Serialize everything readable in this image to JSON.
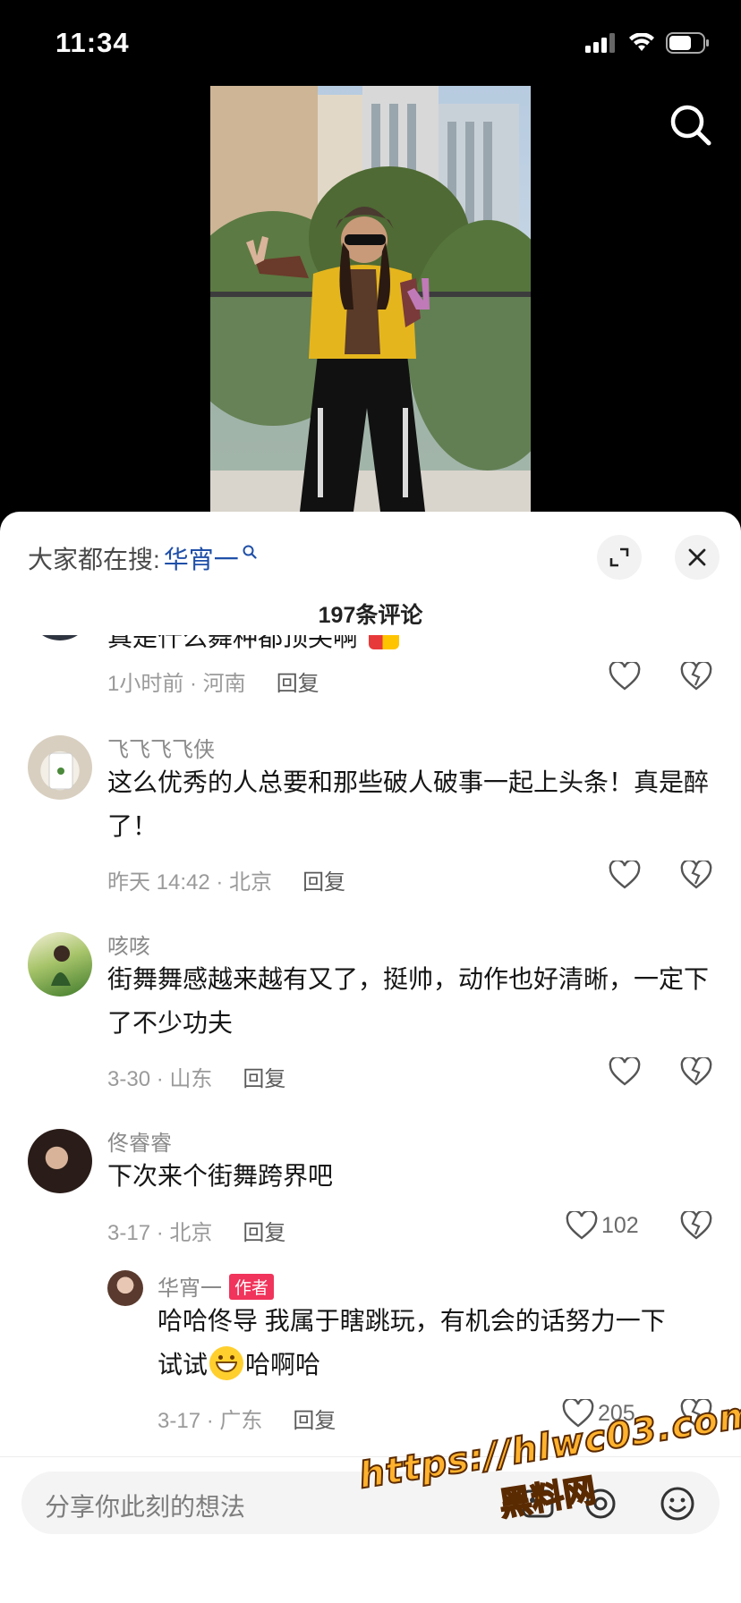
{
  "status_bar": {
    "time": "11:34"
  },
  "sheet": {
    "hot_search_label": "大家都在搜:",
    "hot_search_term": "华宵一",
    "comment_count": "197条评论"
  },
  "comments": [
    {
      "text": "真是什么舞种都顶尖啊",
      "meta": "1小时前 · 河南",
      "reply": "回复"
    },
    {
      "user": "飞飞飞飞侠",
      "text": "这么优秀的人总要和那些破人破事一起上头条！真是醉了！",
      "meta": "昨天 14:42 · 北京",
      "reply": "回复"
    },
    {
      "user": "咳咳",
      "text": "街舞舞感越来越有又了，挺帅，动作也好清晰，一定下了不少功夫",
      "meta": "3-30 · 山东",
      "reply": "回复"
    },
    {
      "user": "佟睿睿",
      "text": "下次来个街舞跨界吧",
      "meta": "3-17 · 北京",
      "reply": "回复",
      "likes": "102"
    }
  ],
  "author_reply": {
    "user": "华宵一",
    "badge": "作者",
    "text_1": "哈哈佟导 我属于瞎跳玩，有机会的话努力一下",
    "text_2": "试试",
    "text_3": "哈啊哈",
    "meta": "3-17 · 广东",
    "reply": "回复",
    "likes": "205"
  },
  "input": {
    "placeholder": "分享你此刻的想法"
  },
  "watermark": {
    "line1": "https://hlwc03.com",
    "line2": "黑料网"
  }
}
